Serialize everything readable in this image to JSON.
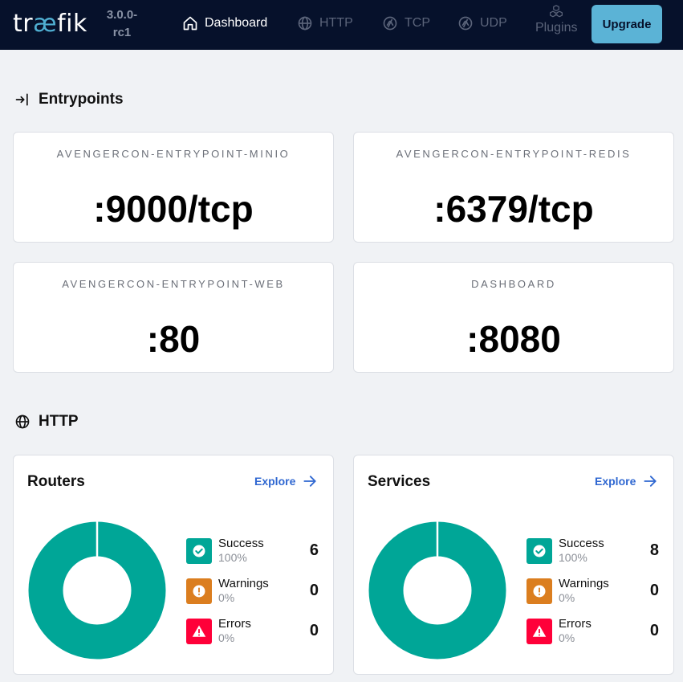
{
  "nav": {
    "logo_pre": "tr",
    "logo_ae": "æ",
    "logo_post": "fik",
    "version_line1": "3.0.0-",
    "version_line2": "rc1",
    "items": [
      {
        "label": "Dashboard",
        "icon": "home-icon",
        "active": true
      },
      {
        "label": "HTTP",
        "icon": "globe-icon",
        "active": false
      },
      {
        "label": "TCP",
        "icon": "tcp-icon",
        "active": false
      },
      {
        "label": "UDP",
        "icon": "udp-icon",
        "active": false
      },
      {
        "label": "Plugins",
        "icon": "cubes-icon",
        "active": false
      }
    ],
    "upgrade_label": "Upgrade"
  },
  "entrypoints": {
    "title": "Entrypoints",
    "cards": [
      {
        "name": "AVENGERCON-ENTRYPOINT-MINIO",
        "address": ":9000/tcp"
      },
      {
        "name": "AVENGERCON-ENTRYPOINT-REDIS",
        "address": ":6379/tcp"
      },
      {
        "name": "AVENGERCON-ENTRYPOINT-WEB",
        "address": ":80"
      },
      {
        "name": "DASHBOARD",
        "address": ":8080"
      }
    ]
  },
  "http": {
    "title": "HTTP",
    "cards": [
      {
        "title": "Routers",
        "explore_label": "Explore",
        "stats": [
          {
            "label": "Success",
            "pct": "100%",
            "count": "6"
          },
          {
            "label": "Warnings",
            "pct": "0%",
            "count": "0"
          },
          {
            "label": "Errors",
            "pct": "0%",
            "count": "0"
          }
        ]
      },
      {
        "title": "Services",
        "explore_label": "Explore",
        "stats": [
          {
            "label": "Success",
            "pct": "100%",
            "count": "8"
          },
          {
            "label": "Warnings",
            "pct": "0%",
            "count": "0"
          },
          {
            "label": "Errors",
            "pct": "0%",
            "count": "0"
          }
        ]
      }
    ]
  },
  "colors": {
    "nav_bg": "#06112b",
    "success": "#00a697",
    "warning": "#db7e1f",
    "error": "#ff0039",
    "link": "#2f67d1",
    "upgrade": "#5bb3d6"
  }
}
